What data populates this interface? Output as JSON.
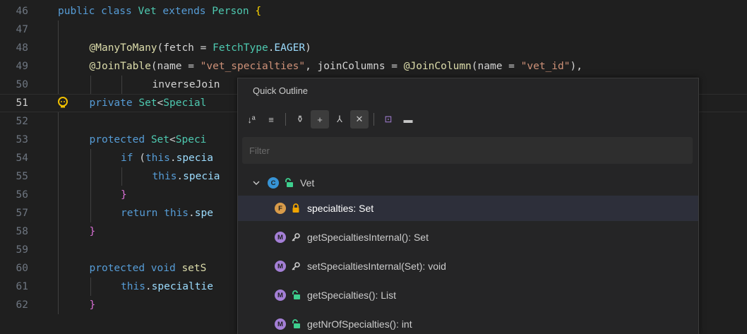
{
  "editor": {
    "lines": [
      {
        "num": "46",
        "tokens": [
          [
            "kw",
            "public class "
          ],
          [
            "ty",
            "Vet "
          ],
          [
            "kw",
            "extends "
          ],
          [
            "ty",
            "Person "
          ],
          [
            "br",
            "{"
          ]
        ]
      },
      {
        "num": "47",
        "tokens": []
      },
      {
        "num": "48",
        "tokens": [
          [
            "an",
            "@ManyToMany"
          ],
          [
            "pl",
            "(fetch = "
          ],
          [
            "ty",
            "FetchType"
          ],
          [
            "pl",
            "."
          ],
          [
            "id",
            "EAGER"
          ],
          [
            "pl",
            ")"
          ]
        ]
      },
      {
        "num": "49",
        "tokens": [
          [
            "an",
            "@JoinTable"
          ],
          [
            "pl",
            "(name = "
          ],
          [
            "st",
            "\"vet_specialties\""
          ],
          [
            "pl",
            ", joinColumns = "
          ],
          [
            "an",
            "@JoinColumn"
          ],
          [
            "pl",
            "(name = "
          ],
          [
            "st",
            "\"vet_id\""
          ],
          [
            "pl",
            "),"
          ]
        ]
      },
      {
        "num": "50",
        "tokens": [
          [
            "pl",
            "inverseJoin"
          ]
        ]
      },
      {
        "num": "51",
        "tokens": [
          [
            "kw",
            "private "
          ],
          [
            "ty",
            "Set"
          ],
          [
            "pl",
            "<"
          ],
          [
            "ty",
            "Special"
          ]
        ]
      },
      {
        "num": "52",
        "tokens": []
      },
      {
        "num": "53",
        "tokens": [
          [
            "kw",
            "protected "
          ],
          [
            "ty",
            "Set"
          ],
          [
            "pl",
            "<"
          ],
          [
            "ty",
            "Speci"
          ]
        ]
      },
      {
        "num": "54",
        "tokens": [
          [
            "kw",
            "if "
          ],
          [
            "pl",
            "("
          ],
          [
            "kw",
            "this"
          ],
          [
            "pl",
            "."
          ],
          [
            "id",
            "specia"
          ]
        ]
      },
      {
        "num": "55",
        "tokens": [
          [
            "kw",
            "this"
          ],
          [
            "pl",
            "."
          ],
          [
            "id",
            "specia"
          ]
        ]
      },
      {
        "num": "56",
        "tokens": [
          [
            "br2",
            "}"
          ]
        ]
      },
      {
        "num": "57",
        "tokens": [
          [
            "kw",
            "return "
          ],
          [
            "kw",
            "this"
          ],
          [
            "pl",
            "."
          ],
          [
            "id",
            "spe"
          ]
        ]
      },
      {
        "num": "58",
        "tokens": [
          [
            "br2",
            "}"
          ]
        ]
      },
      {
        "num": "59",
        "tokens": []
      },
      {
        "num": "60",
        "tokens": [
          [
            "kw",
            "protected void "
          ],
          [
            "an",
            "setS"
          ]
        ]
      },
      {
        "num": "61",
        "tokens": [
          [
            "kw",
            "this"
          ],
          [
            "pl",
            "."
          ],
          [
            "id",
            "specialtie"
          ]
        ]
      },
      {
        "num": "62",
        "tokens": [
          [
            "br2",
            "}"
          ]
        ]
      }
    ]
  },
  "outline": {
    "title": "Quick Outline",
    "filter_placeholder": "Filter",
    "toolbar": [
      {
        "icon": "sort-alphabetically-icon",
        "glyph": "↓ª",
        "on": false
      },
      {
        "icon": "sort-by-position-icon",
        "glyph": "≡",
        "on": false
      },
      {
        "icon": "hierarchy-icon",
        "glyph": "⚱",
        "on": false
      },
      {
        "icon": "expand-all-icon",
        "glyph": "+",
        "on": true
      },
      {
        "icon": "inherited-members-icon",
        "glyph": "⅄",
        "on": false
      },
      {
        "icon": "close-icon",
        "glyph": "✕",
        "on": true
      },
      {
        "icon": "module-icon",
        "glyph": "⊡",
        "on": false
      },
      {
        "icon": "folder-icon",
        "glyph": "▬",
        "on": false
      }
    ],
    "items": [
      {
        "label": "Vet",
        "kind": "C",
        "vis": "public",
        "expander": true,
        "indent": 0,
        "selected": false
      },
      {
        "label": "specialties: Set",
        "kind": "F",
        "vis": "private",
        "expander": false,
        "indent": 1,
        "selected": true
      },
      {
        "label": "getSpecialtiesInternal(): Set",
        "kind": "M",
        "vis": "protected",
        "expander": false,
        "indent": 1,
        "selected": false
      },
      {
        "label": "setSpecialtiesInternal(Set): void",
        "kind": "M",
        "vis": "protected",
        "expander": false,
        "indent": 1,
        "selected": false
      },
      {
        "label": "getSpecialties(): List",
        "kind": "M",
        "vis": "public",
        "expander": false,
        "indent": 1,
        "selected": false
      },
      {
        "label": "getNrOfSpecialties(): int",
        "kind": "M",
        "vis": "public",
        "expander": false,
        "indent": 1,
        "selected": false
      }
    ]
  },
  "colors": {
    "class": "#3794d6",
    "field": "#d89b4a",
    "method": "#a47fd6",
    "public": "#3ecf8e",
    "private": "#f0a400",
    "protected": "#cccccc"
  }
}
